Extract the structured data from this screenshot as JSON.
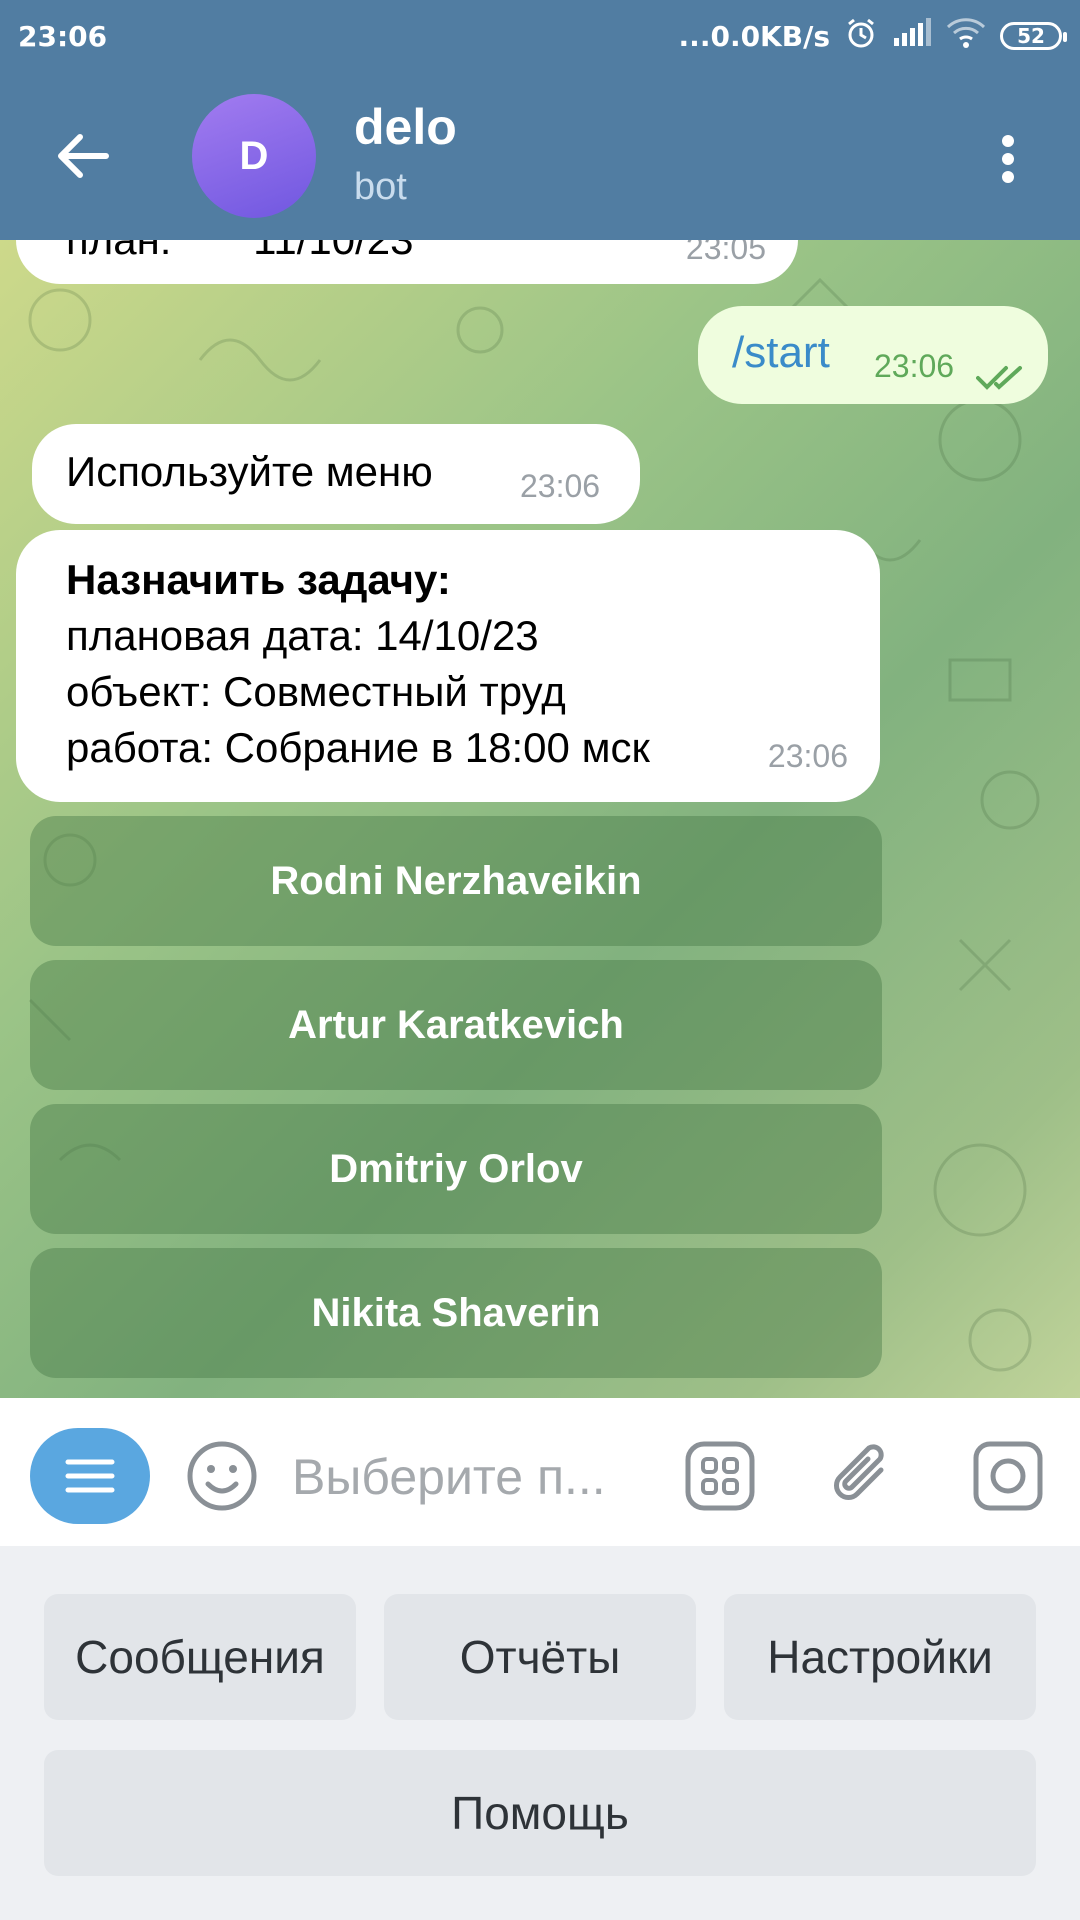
{
  "status_bar": {
    "time": "23:06",
    "network_speed": "...0.0KB/s",
    "battery": "52",
    "icons": [
      "alarm-icon",
      "signal-icon",
      "wifi-icon",
      "battery-icon"
    ]
  },
  "header": {
    "avatar_letter": "D",
    "title": "delo",
    "subtitle": "bot",
    "colors": {
      "bar": "#517da2",
      "avatar": "#8a6ce8"
    }
  },
  "messages": {
    "partial": {
      "text": "план:       11/10/23",
      "time": "23:05"
    },
    "outgoing": {
      "text": "/start",
      "time": "23:06",
      "status": "read"
    },
    "menu_hint": {
      "text": "Используйте меню",
      "time": "23:06"
    },
    "task": {
      "title": "Назначить задачу:",
      "lines": [
        "плановая дата: 14/10/23",
        "объект: Совместный труд",
        "работа: Собрание в 18:00 мск"
      ],
      "time": "23:06"
    }
  },
  "inline_keyboard": [
    "Rodni Nerzhaveikin",
    "Artur Karatkevich",
    "Dmitriy Orlov",
    "Nikita Shaverin"
  ],
  "input": {
    "placeholder": "Выберите п..."
  },
  "reply_keyboard": {
    "row1": [
      "Сообщения",
      "Отчёты",
      "Настройки"
    ],
    "row2": [
      "Помощь"
    ]
  }
}
